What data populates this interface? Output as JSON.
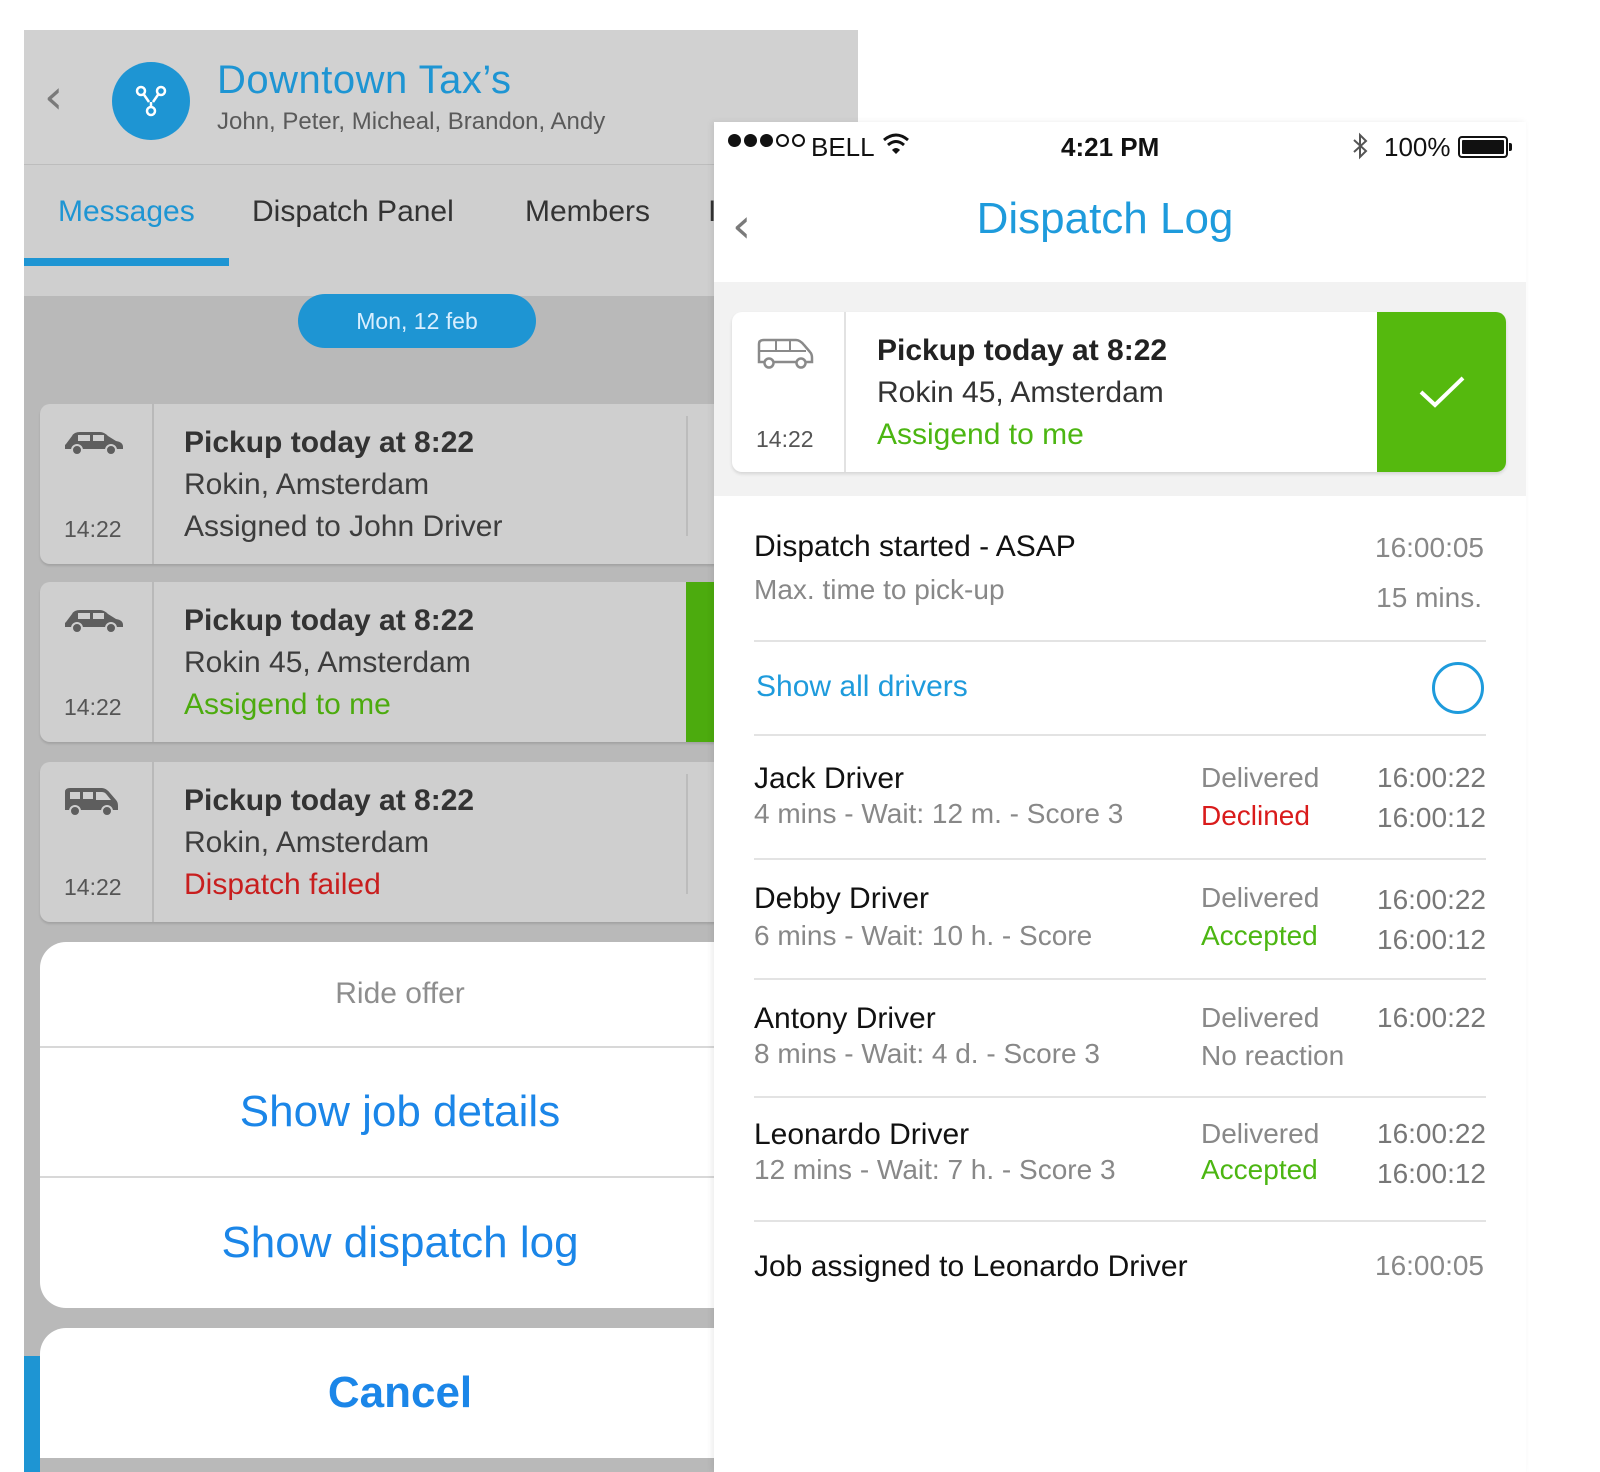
{
  "left": {
    "header": {
      "title": "Downtown Tax’s",
      "members": "John, Peter, Micheal, Brandon, Andy"
    },
    "tabs": [
      {
        "label": "Messages",
        "active": true
      },
      {
        "label": "Dispatch Panel",
        "active": false
      },
      {
        "label": "Members",
        "active": false
      },
      {
        "label": "I",
        "active": false
      }
    ],
    "date_pill": "Mon, 12 feb",
    "messages": [
      {
        "vehicle": "car-icon",
        "time": "14:22",
        "title": "Pickup today at 8:22",
        "address": "Rokin, Amsterdam",
        "status": "Assigned to John Driver",
        "status_color": "#3d3d3d"
      },
      {
        "vehicle": "car-icon",
        "time": "14:22",
        "title": "Pickup today at 8:22",
        "address": "Rokin 45, Amsterdam",
        "status": "Assigend to me",
        "status_color": "#4cab0e"
      },
      {
        "vehicle": "van-icon",
        "time": "14:22",
        "title": "Pickup today at 8:22",
        "address": "Rokin, Amsterdam",
        "status": "Dispatch failed",
        "status_color": "#c81e1e"
      }
    ],
    "action_sheet": {
      "title": "Ride offer",
      "show_job_details": "Show job details",
      "show_dispatch_log": "Show dispatch log",
      "cancel": "Cancel"
    }
  },
  "right": {
    "status_bar": {
      "carrier": "BELL",
      "time": "4:21 PM",
      "battery": "100%"
    },
    "nav": {
      "title": "Dispatch Log"
    },
    "job_card": {
      "vehicle": "van-icon",
      "time": "14:22",
      "title": "Pickup today at 8:22",
      "address": "Rokin 45, Amsterdam",
      "status": "Assigend to me"
    },
    "dispatch": {
      "title": "Dispatch started - ASAP",
      "subtitle": "Max. time to pick-up",
      "time": "16:00:05",
      "max_time": "15 mins."
    },
    "show_all_drivers": "Show all drivers",
    "drivers": [
      {
        "name": "Jack Driver",
        "details": "4 mins - Wait: 12 m. - Score 3",
        "status1": "Delivered",
        "status2": "Declined",
        "status2_type": "declined",
        "time1": "16:00:22",
        "time2": "16:00:12"
      },
      {
        "name": "Debby Driver",
        "details": "6 mins - Wait: 10 h. - Score",
        "status1": "Delivered",
        "status2": "Accepted",
        "status2_type": "accepted",
        "time1": "16:00:22",
        "time2": "16:00:12"
      },
      {
        "name": "Antony Driver",
        "details": "8 mins - Wait: 4 d. - Score 3",
        "status1": "Delivered",
        "status2": "No reaction",
        "status2_type": "none",
        "time1": "16:00:22",
        "time2": ""
      },
      {
        "name": "Leonardo Driver",
        "details": "12 mins - Wait: 7 h. - Score 3",
        "status1": "Delivered",
        "status2": "Accepted",
        "status2_type": "accepted",
        "time1": "16:00:22",
        "time2": "16:00:12"
      }
    ],
    "assigned": {
      "text": "Job assigned to Leonardo Driver",
      "time": "16:00:05"
    }
  }
}
